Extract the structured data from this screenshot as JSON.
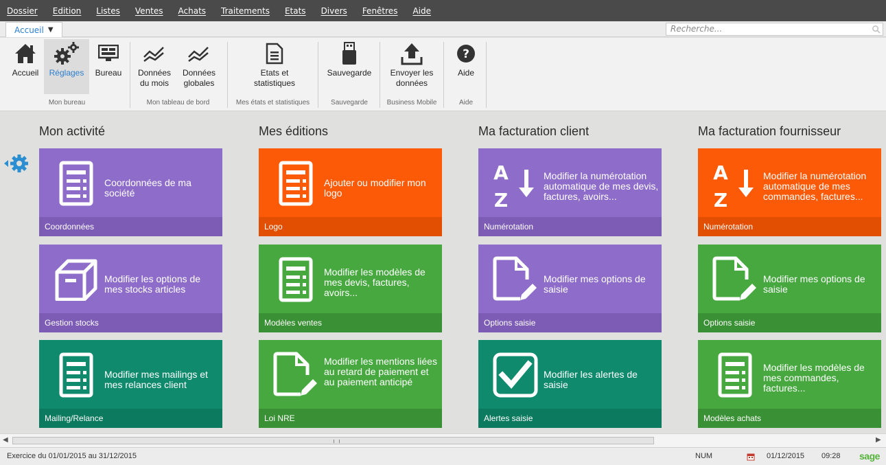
{
  "menu": [
    "Dossier",
    "Edition",
    "Listes",
    "Ventes",
    "Achats",
    "Traitements",
    "Etats",
    "Divers",
    "Fenêtres",
    "Aide"
  ],
  "tab": {
    "label": "Accueil"
  },
  "search": {
    "placeholder": "Recherche..."
  },
  "ribbon": {
    "buttons": [
      {
        "label": "Accueil",
        "icon": "home-icon"
      },
      {
        "label": "Réglages",
        "icon": "gears-icon",
        "active": true
      },
      {
        "label": "Bureau",
        "icon": "desktop-icon"
      },
      {
        "label": "Données du mois",
        "icon": "chart-line-icon"
      },
      {
        "label": "Données globales",
        "icon": "chart-line-icon"
      },
      {
        "label": "Etats et statistiques",
        "icon": "document-icon"
      },
      {
        "label": "Sauvegarde",
        "icon": "usb-drive-icon"
      },
      {
        "label": "Envoyer les données",
        "icon": "upload-icon"
      },
      {
        "label": "Aide",
        "icon": "help-icon"
      }
    ],
    "groups": [
      "Mon bureau",
      "Mon tableau de bord",
      "Mes états et statistiques",
      "Sauvegarde",
      "Business Mobile",
      "Aide"
    ]
  },
  "columns": [
    {
      "title": "Mon activité",
      "tiles": [
        {
          "text": "Coordonnées de ma société",
          "footer": "Coordonnées",
          "color": "purple",
          "icon": "form-icon"
        },
        {
          "text": "Modifier les options de mes stocks articles",
          "footer": "Gestion stocks",
          "color": "purple",
          "icon": "box-icon"
        },
        {
          "text": "Modifier mes mailings et mes relances client",
          "footer": "Mailing/Relance",
          "color": "teal",
          "icon": "form-icon"
        }
      ]
    },
    {
      "title": "Mes éditions",
      "tiles": [
        {
          "text": "Ajouter ou modifier mon logo",
          "footer": "Logo",
          "color": "orange",
          "icon": "form-icon"
        },
        {
          "text": "Modifier les modèles de mes devis, factures, avoirs...",
          "footer": "Modèles ventes",
          "color": "green",
          "icon": "form-icon"
        },
        {
          "text": "Modifier les mentions liées au retard de paiement et au paiement anticipé",
          "footer": "Loi NRE",
          "color": "green",
          "icon": "edit-document-icon"
        }
      ]
    },
    {
      "title": "Ma facturation client",
      "tiles": [
        {
          "text": "Modifier la numérotation automatique de mes devis, factures, avoirs...",
          "footer": "Numérotation",
          "color": "purple",
          "icon": "sort-az-icon"
        },
        {
          "text": "Modifier mes options de saisie",
          "footer": "Options saisie",
          "color": "purple",
          "icon": "edit-document-icon"
        },
        {
          "text": "Modifier les alertes de saisie",
          "footer": "Alertes saisie",
          "color": "teal",
          "icon": "checkbox-icon"
        }
      ]
    },
    {
      "title": "Ma facturation fournisseur",
      "tiles": [
        {
          "text": "Modifier la numérotation automatique de mes commandes, factures...",
          "footer": "Numérotation",
          "color": "orange",
          "icon": "sort-az-icon"
        },
        {
          "text": "Modifier mes options de saisie",
          "footer": "Options saisie",
          "color": "green",
          "icon": "edit-document-icon"
        },
        {
          "text": "Modifier les modèles de mes commandes, factures...",
          "footer": "Modèles achats",
          "color": "green",
          "icon": "form-icon"
        }
      ]
    }
  ],
  "status": {
    "exercise": "Exercice du 01/01/2015 au 31/12/2015",
    "num": "NUM",
    "date": "01/12/2015",
    "time": "09:28",
    "logo": "sage"
  }
}
